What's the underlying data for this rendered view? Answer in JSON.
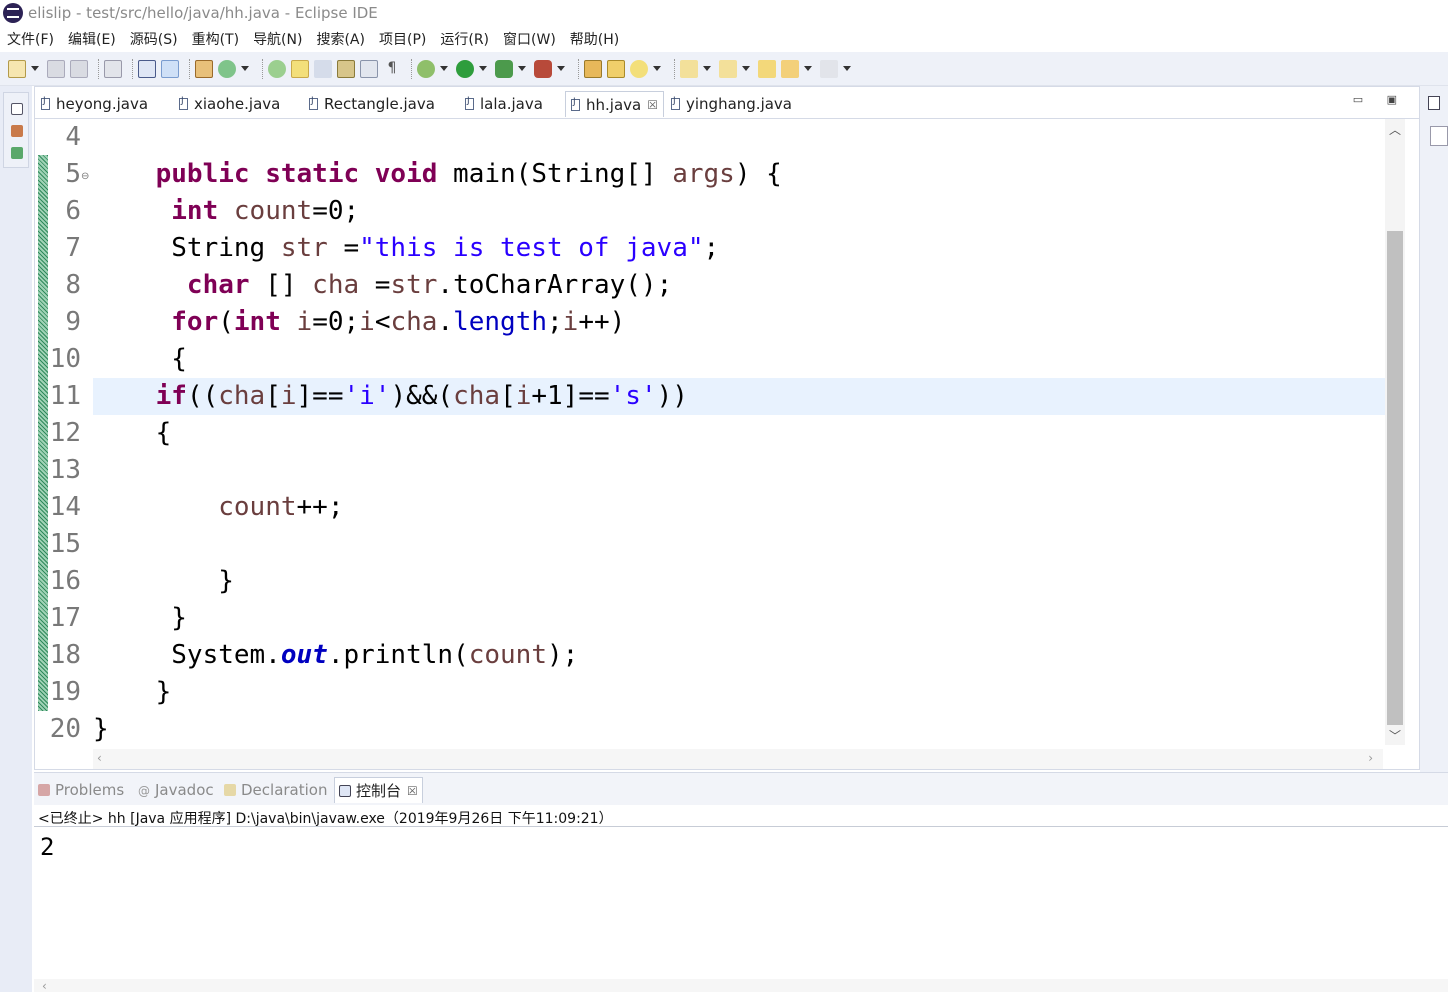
{
  "window": {
    "title": "elislip - test/src/hello/java/hh.java - Eclipse IDE"
  },
  "menu": [
    "文件(F)",
    "编辑(E)",
    "源码(S)",
    "重构(T)",
    "导航(N)",
    "搜索(A)",
    "项目(P)",
    "运行(R)",
    "窗口(W)",
    "帮助(H)"
  ],
  "editor": {
    "tabs": [
      {
        "label": "heyong.java"
      },
      {
        "label": "xiaohe.java"
      },
      {
        "label": "Rectangle.java"
      },
      {
        "label": "lala.java"
      },
      {
        "label": "hh.java",
        "close": "☒"
      },
      {
        "label": "yinghang.java"
      }
    ],
    "active_tab": "hh.java",
    "line_numbers": [
      "4",
      "5",
      "6",
      "7",
      "8",
      "9",
      "10",
      "11",
      "12",
      "13",
      "14",
      "15",
      "16",
      "17",
      "18",
      "19",
      "20"
    ],
    "current_line": "11",
    "code": [
      {
        "tokens": []
      },
      {
        "tokens": [
          {
            "t": "    "
          },
          {
            "t": "public",
            "c": "kw"
          },
          {
            "t": " "
          },
          {
            "t": "static",
            "c": "kw"
          },
          {
            "t": " "
          },
          {
            "t": "void",
            "c": "kw"
          },
          {
            "t": " main(String[] "
          },
          {
            "t": "args",
            "c": "var"
          },
          {
            "t": ") {"
          }
        ]
      },
      {
        "tokens": [
          {
            "t": "     "
          },
          {
            "t": "int",
            "c": "kw"
          },
          {
            "t": " "
          },
          {
            "t": "count",
            "c": "var"
          },
          {
            "t": "=0;"
          }
        ]
      },
      {
        "tokens": [
          {
            "t": "     String "
          },
          {
            "t": "str",
            "c": "var"
          },
          {
            "t": " ="
          },
          {
            "t": "\"this is test of java\"",
            "c": "str"
          },
          {
            "t": ";"
          }
        ]
      },
      {
        "tokens": [
          {
            "t": "      "
          },
          {
            "t": "char",
            "c": "kw"
          },
          {
            "t": " [] "
          },
          {
            "t": "cha",
            "c": "var"
          },
          {
            "t": " ="
          },
          {
            "t": "str",
            "c": "var"
          },
          {
            "t": ".toCharArray();"
          }
        ]
      },
      {
        "tokens": [
          {
            "t": "     "
          },
          {
            "t": "for",
            "c": "kw"
          },
          {
            "t": "("
          },
          {
            "t": "int",
            "c": "kw"
          },
          {
            "t": " "
          },
          {
            "t": "i",
            "c": "var"
          },
          {
            "t": "=0;"
          },
          {
            "t": "i",
            "c": "var"
          },
          {
            "t": "<"
          },
          {
            "t": "cha",
            "c": "var"
          },
          {
            "t": "."
          },
          {
            "t": "length",
            "c": "fld"
          },
          {
            "t": ";"
          },
          {
            "t": "i",
            "c": "var"
          },
          {
            "t": "++)"
          }
        ]
      },
      {
        "tokens": [
          {
            "t": "     {"
          }
        ]
      },
      {
        "tokens": [
          {
            "t": "    "
          },
          {
            "t": "if",
            "c": "kw"
          },
          {
            "t": "(("
          },
          {
            "t": "cha",
            "c": "var"
          },
          {
            "t": "["
          },
          {
            "t": "i",
            "c": "var"
          },
          {
            "t": "]=="
          },
          {
            "t": "'i'",
            "c": "str"
          },
          {
            "t": ")&&("
          },
          {
            "t": "cha",
            "c": "var"
          },
          {
            "t": "["
          },
          {
            "t": "i",
            "c": "var"
          },
          {
            "t": "+1]=="
          },
          {
            "t": "'s'",
            "c": "str"
          },
          {
            "t": "))"
          }
        ]
      },
      {
        "tokens": [
          {
            "t": "    {"
          }
        ]
      },
      {
        "tokens": []
      },
      {
        "tokens": [
          {
            "t": "        "
          },
          {
            "t": "count",
            "c": "var"
          },
          {
            "t": "++;"
          }
        ]
      },
      {
        "tokens": []
      },
      {
        "tokens": [
          {
            "t": "        }"
          }
        ]
      },
      {
        "tokens": [
          {
            "t": "     }"
          }
        ]
      },
      {
        "tokens": [
          {
            "t": "     System."
          },
          {
            "t": "out",
            "c": "sfld"
          },
          {
            "t": ".println("
          },
          {
            "t": "count",
            "c": "var"
          },
          {
            "t": ");"
          }
        ]
      },
      {
        "tokens": [
          {
            "t": "    }"
          }
        ]
      },
      {
        "tokens": [
          {
            "t": "}"
          }
        ]
      }
    ]
  },
  "console": {
    "tabs": [
      {
        "label": "Problems",
        "icon": "problems-icon"
      },
      {
        "label": "Javadoc",
        "icon": "javadoc-icon"
      },
      {
        "label": "Declaration",
        "icon": "declaration-icon"
      },
      {
        "label": "控制台",
        "icon": "console-icon",
        "close": "☒"
      }
    ],
    "header": "<已终止> hh [Java 应用程序] D:\\java\\bin\\javaw.exe（2019年9月26日 下午11:09:21）",
    "output": "2"
  }
}
